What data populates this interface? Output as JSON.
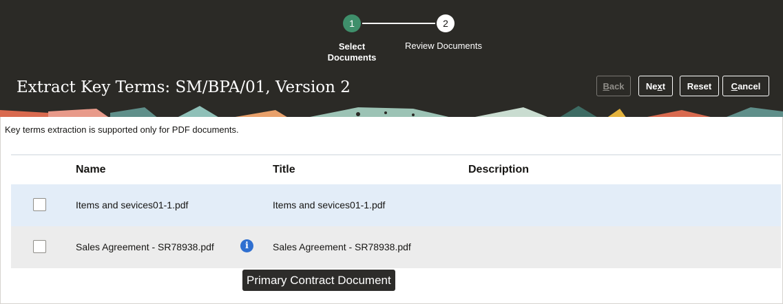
{
  "train": {
    "steps": [
      {
        "number": "1",
        "label": "Select Documents",
        "state": "current"
      },
      {
        "number": "2",
        "label": "Review Documents",
        "state": "pending"
      }
    ],
    "step1_label_line1": "Select",
    "step1_label_line2": "Documents"
  },
  "header": {
    "title": "Extract Key Terms: SM/BPA/01, Version 2",
    "buttons": {
      "back": {
        "pre": "",
        "ul": "B",
        "post": "ack",
        "enabled": false
      },
      "next": {
        "pre": "Ne",
        "ul": "x",
        "post": "t",
        "enabled": true
      },
      "reset": {
        "pre": "Reset",
        "ul": "",
        "post": "",
        "enabled": true
      },
      "cancel": {
        "pre": "",
        "ul": "C",
        "post": "ancel",
        "enabled": true
      }
    }
  },
  "notice": "Key terms extraction is supported only for PDF documents.",
  "table": {
    "columns": [
      "Name",
      "Title",
      "Description"
    ],
    "rows": [
      {
        "name": "Items and sevices01-1.pdf",
        "title": "Items and sevices01-1.pdf",
        "description": "",
        "checked": false,
        "has_info": false
      },
      {
        "name": "Sales Agreement - SR78938.pdf",
        "title": "Sales Agreement - SR78938.pdf",
        "description": "",
        "checked": false,
        "has_info": true
      }
    ]
  },
  "tooltip": "Primary Contract Document",
  "colors": {
    "header_bg": "#2b2a26",
    "step_active": "#3f8f6b",
    "row_selected": "#e3edf8",
    "row_hover": "#ececec",
    "info_icon": "#2f6fd0"
  }
}
